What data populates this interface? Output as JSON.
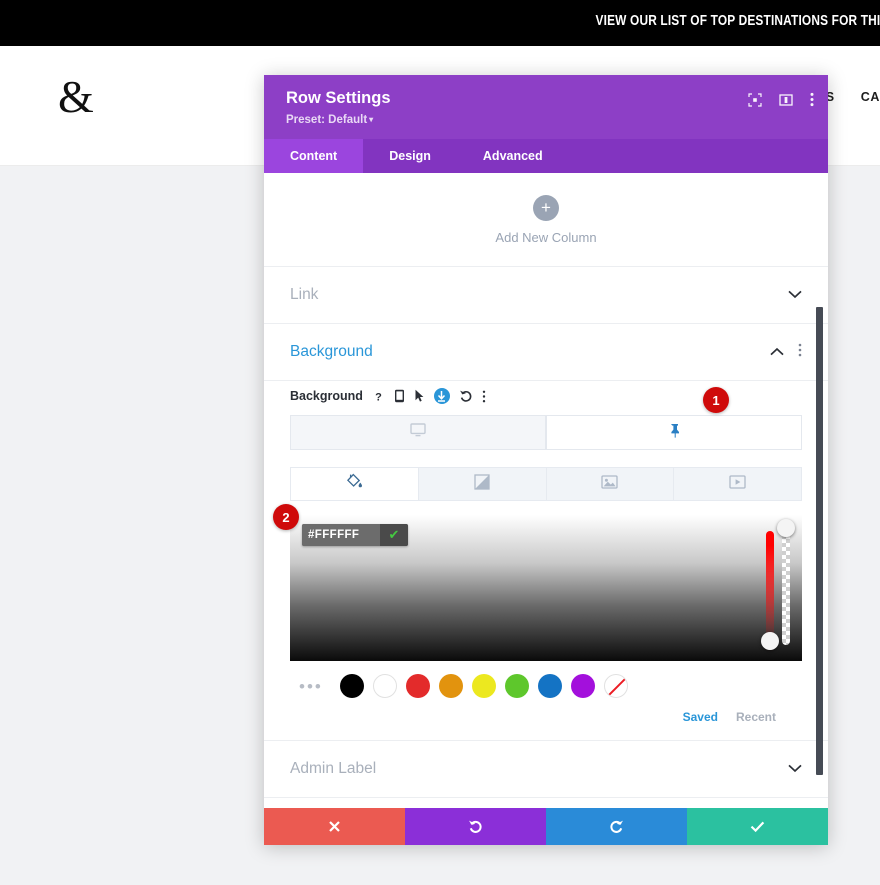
{
  "site": {
    "banner_text": "VIEW OUR LIST OF TOP DESTINATIONS FOR THI",
    "logo": "&",
    "nav": [
      "IES",
      "CA"
    ]
  },
  "modal": {
    "title": "Row Settings",
    "preset_label": "Preset: Default",
    "preset_caret": "▾",
    "header_icons": [
      {
        "name": "fullscreen-icon",
        "glyph": "⬚"
      },
      {
        "name": "layout-panel-icon",
        "glyph": "▣"
      },
      {
        "name": "more-options-icon",
        "glyph": "⋮"
      }
    ],
    "tabs": [
      {
        "label": "Content",
        "active": true
      },
      {
        "label": "Design",
        "active": false
      },
      {
        "label": "Advanced",
        "active": false
      }
    ],
    "add_column": {
      "plus": "+",
      "label": "Add New Column"
    },
    "sections": [
      {
        "title": "Link",
        "open": false,
        "chevron": "∨"
      },
      {
        "title": "Background",
        "open": true,
        "chevron": "∧",
        "menu": "⋮"
      },
      {
        "title": "Admin Label",
        "open": false,
        "chevron": "∨"
      }
    ],
    "background": {
      "field_label": "Background",
      "field_icons": [
        {
          "name": "help-icon",
          "glyph": "?"
        },
        {
          "name": "responsive-icon",
          "glyph": "▯"
        },
        {
          "name": "hover-cursor-icon",
          "glyph": "➤"
        },
        {
          "name": "sticky-state-icon",
          "glyph": "↓"
        },
        {
          "name": "reset-icon",
          "glyph": "↺"
        },
        {
          "name": "field-options-icon",
          "glyph": "⋮"
        }
      ],
      "state_tabs": [
        {
          "name": "desktop-state-tab",
          "icon": "desktop-icon",
          "active": false
        },
        {
          "name": "sticky-state-tab",
          "icon": "pin-icon",
          "active": true
        }
      ],
      "type_tabs": [
        {
          "name": "background-color-tab",
          "icon": "paint-bucket-icon",
          "active": true
        },
        {
          "name": "background-gradient-tab",
          "icon": "gradient-icon",
          "active": false
        },
        {
          "name": "background-image-tab",
          "icon": "image-icon",
          "active": false
        },
        {
          "name": "background-video-tab",
          "icon": "video-icon",
          "active": false
        }
      ],
      "hex_value": "#FFFFFF",
      "hex_confirm": "✔",
      "swatch_more": "•••",
      "swatches": [
        {
          "name": "swatch-black",
          "color": "#000000"
        },
        {
          "name": "swatch-white",
          "color": "#ffffff"
        },
        {
          "name": "swatch-red",
          "color": "#e32b2b"
        },
        {
          "name": "swatch-orange",
          "color": "#e2930e"
        },
        {
          "name": "swatch-yellow",
          "color": "#ece81f"
        },
        {
          "name": "swatch-green",
          "color": "#5ec72c"
        },
        {
          "name": "swatch-blue",
          "color": "#1473c4"
        },
        {
          "name": "swatch-purple",
          "color": "#a310dc"
        },
        {
          "name": "swatch-transparent",
          "color": "transparent"
        }
      ],
      "saved_label": "Saved",
      "recent_label": "Recent"
    },
    "footer": [
      {
        "name": "discard-button",
        "glyph": "✖",
        "color": "#eb5a51"
      },
      {
        "name": "undo-button",
        "glyph": "↺",
        "color": "#8b2fd8"
      },
      {
        "name": "redo-button",
        "glyph": "↻",
        "color": "#2a8bd8"
      },
      {
        "name": "save-button",
        "glyph": "✔",
        "color": "#2bc1a0"
      }
    ]
  },
  "callouts": [
    {
      "name": "callout-badge-1",
      "label": "1"
    },
    {
      "name": "callout-badge-2",
      "label": "2"
    }
  ]
}
